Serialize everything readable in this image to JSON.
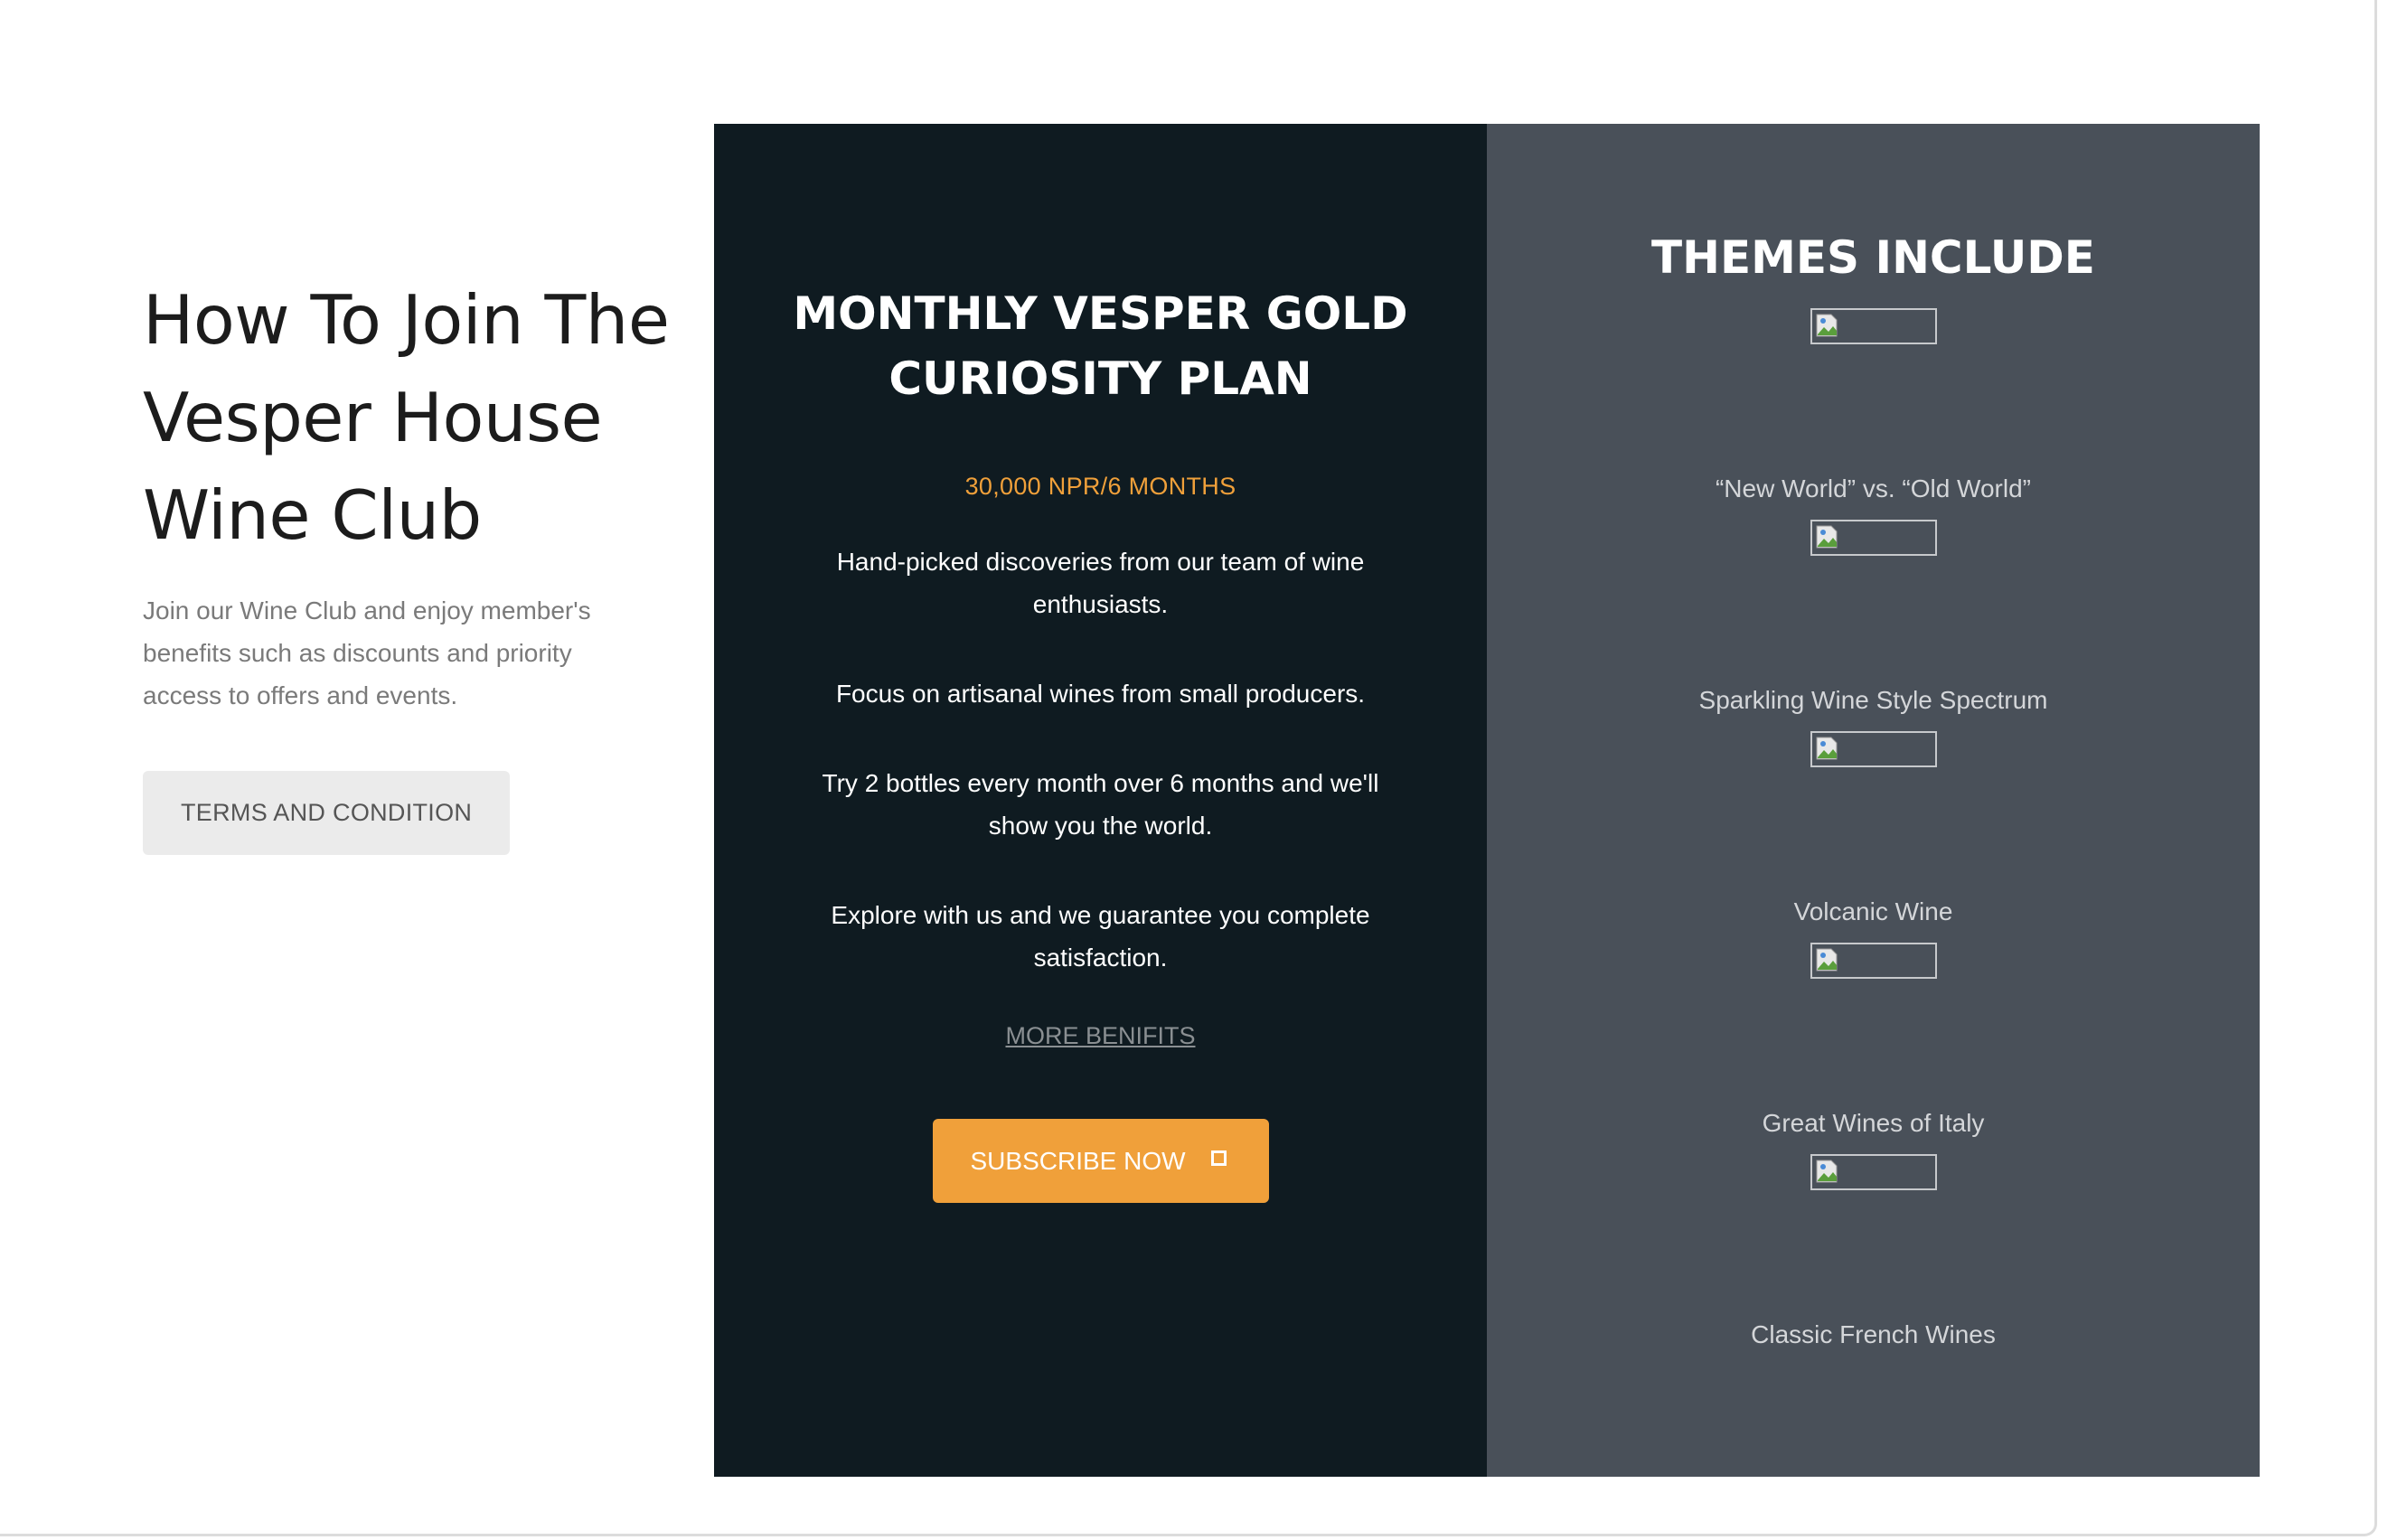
{
  "intro": {
    "title": "How To Join The Vesper House Wine Club",
    "text": "Join our Wine Club and enjoy member's benefits such as discounts and priority access to offers and events.",
    "terms_button": "TERMS AND CONDITION"
  },
  "plan": {
    "title": "MONTHLY VESPER GOLD CURIOSITY PLAN",
    "price": "30,000 NPR/6 MONTHS",
    "benefits": [
      "Hand-picked discoveries from our team of wine enthusiasts.",
      "Focus on artisanal wines from small producers.",
      "Try 2 bottles every month over 6 months and we'll show you the world.",
      "Explore with us and we guarantee you complete satisfaction."
    ],
    "more_link": "MORE BENIFITS",
    "subscribe_button": "SUBSCRIBE NOW",
    "subscribe_icon": "square-icon",
    "accent_color": "#f0a03a"
  },
  "themes": {
    "title": "THEMES INCLUDE",
    "items": [
      "“New World” vs. “Old World”",
      "Sparkling Wine Style Spectrum",
      "Volcanic Wine",
      "Great Wines of Italy",
      "Classic French Wines"
    ]
  }
}
